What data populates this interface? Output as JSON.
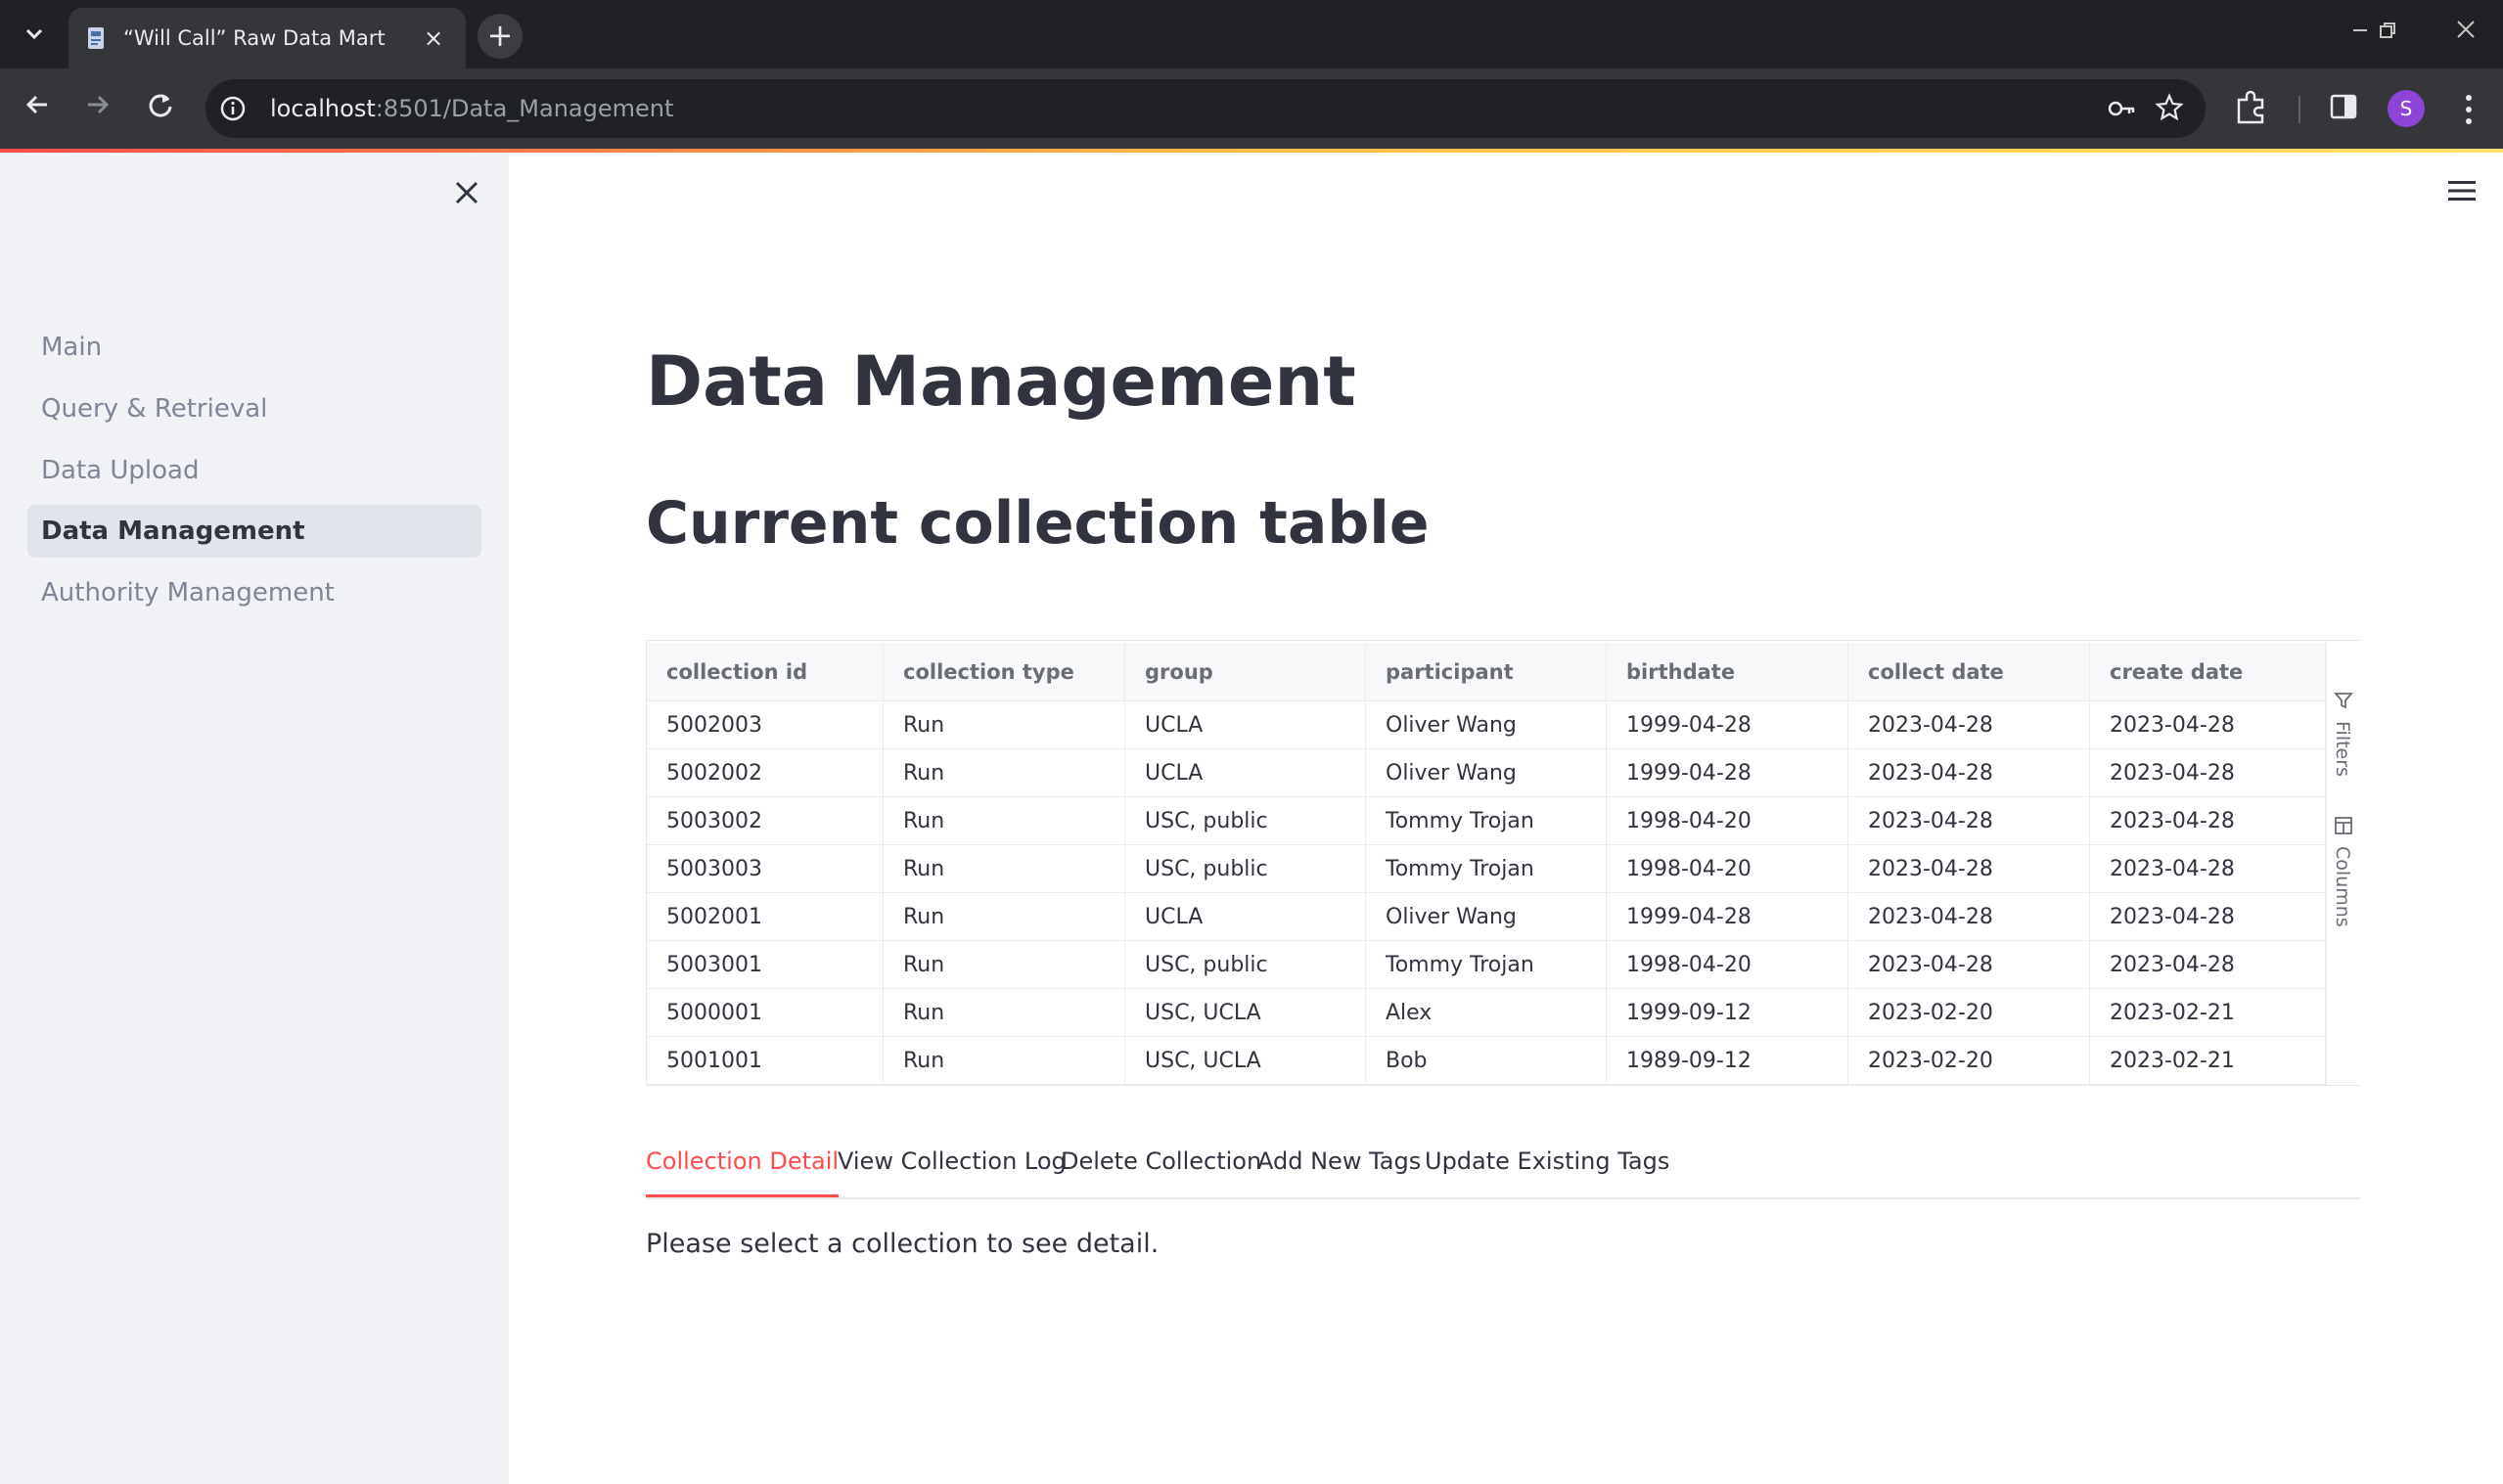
{
  "browser": {
    "tab_title": "“Will Call” Raw Data Mart",
    "url_host": "localhost",
    "url_path": ":8501/Data_Management",
    "avatar_initial": "S",
    "accent_color": "#ff4b4b"
  },
  "sidebar": {
    "items": [
      {
        "label": "Main",
        "active": false
      },
      {
        "label": "Query & Retrieval",
        "active": false
      },
      {
        "label": "Data Upload",
        "active": false
      },
      {
        "label": "Data Management",
        "active": true
      },
      {
        "label": "Authority Management",
        "active": false
      }
    ]
  },
  "main": {
    "title": "Data Management",
    "section_title": "Current collection table",
    "table": {
      "columns": [
        "collection id",
        "collection type",
        "group",
        "participant",
        "birthdate",
        "collect date",
        "create date"
      ],
      "rows": [
        [
          "5002003",
          "Run",
          "UCLA",
          "Oliver Wang",
          "1999-04-28",
          "2023-04-28",
          "2023-04-28"
        ],
        [
          "5002002",
          "Run",
          "UCLA",
          "Oliver Wang",
          "1999-04-28",
          "2023-04-28",
          "2023-04-28"
        ],
        [
          "5003002",
          "Run",
          "USC, public",
          "Tommy Trojan",
          "1998-04-20",
          "2023-04-28",
          "2023-04-28"
        ],
        [
          "5003003",
          "Run",
          "USC, public",
          "Tommy Trojan",
          "1998-04-20",
          "2023-04-28",
          "2023-04-28"
        ],
        [
          "5002001",
          "Run",
          "UCLA",
          "Oliver Wang",
          "1999-04-28",
          "2023-04-28",
          "2023-04-28"
        ],
        [
          "5003001",
          "Run",
          "USC, public",
          "Tommy Trojan",
          "1998-04-20",
          "2023-04-28",
          "2023-04-28"
        ],
        [
          "5000001",
          "Run",
          "USC, UCLA",
          "Alex",
          "1999-09-12",
          "2023-02-20",
          "2023-02-21"
        ],
        [
          "5001001",
          "Run",
          "USC, UCLA",
          "Bob",
          "1989-09-12",
          "2023-02-20",
          "2023-02-21"
        ]
      ],
      "side_tools": {
        "filters_label": "Filters",
        "columns_label": "Columns"
      }
    },
    "tabs": [
      {
        "label": "Collection Detail",
        "active": true
      },
      {
        "label": "View Collection Log",
        "active": false
      },
      {
        "label": "Delete Collection",
        "active": false
      },
      {
        "label": "Add New Tags",
        "active": false
      },
      {
        "label": "Update Existing Tags",
        "active": false
      }
    ],
    "detail_message": "Please select a collection to see detail."
  }
}
